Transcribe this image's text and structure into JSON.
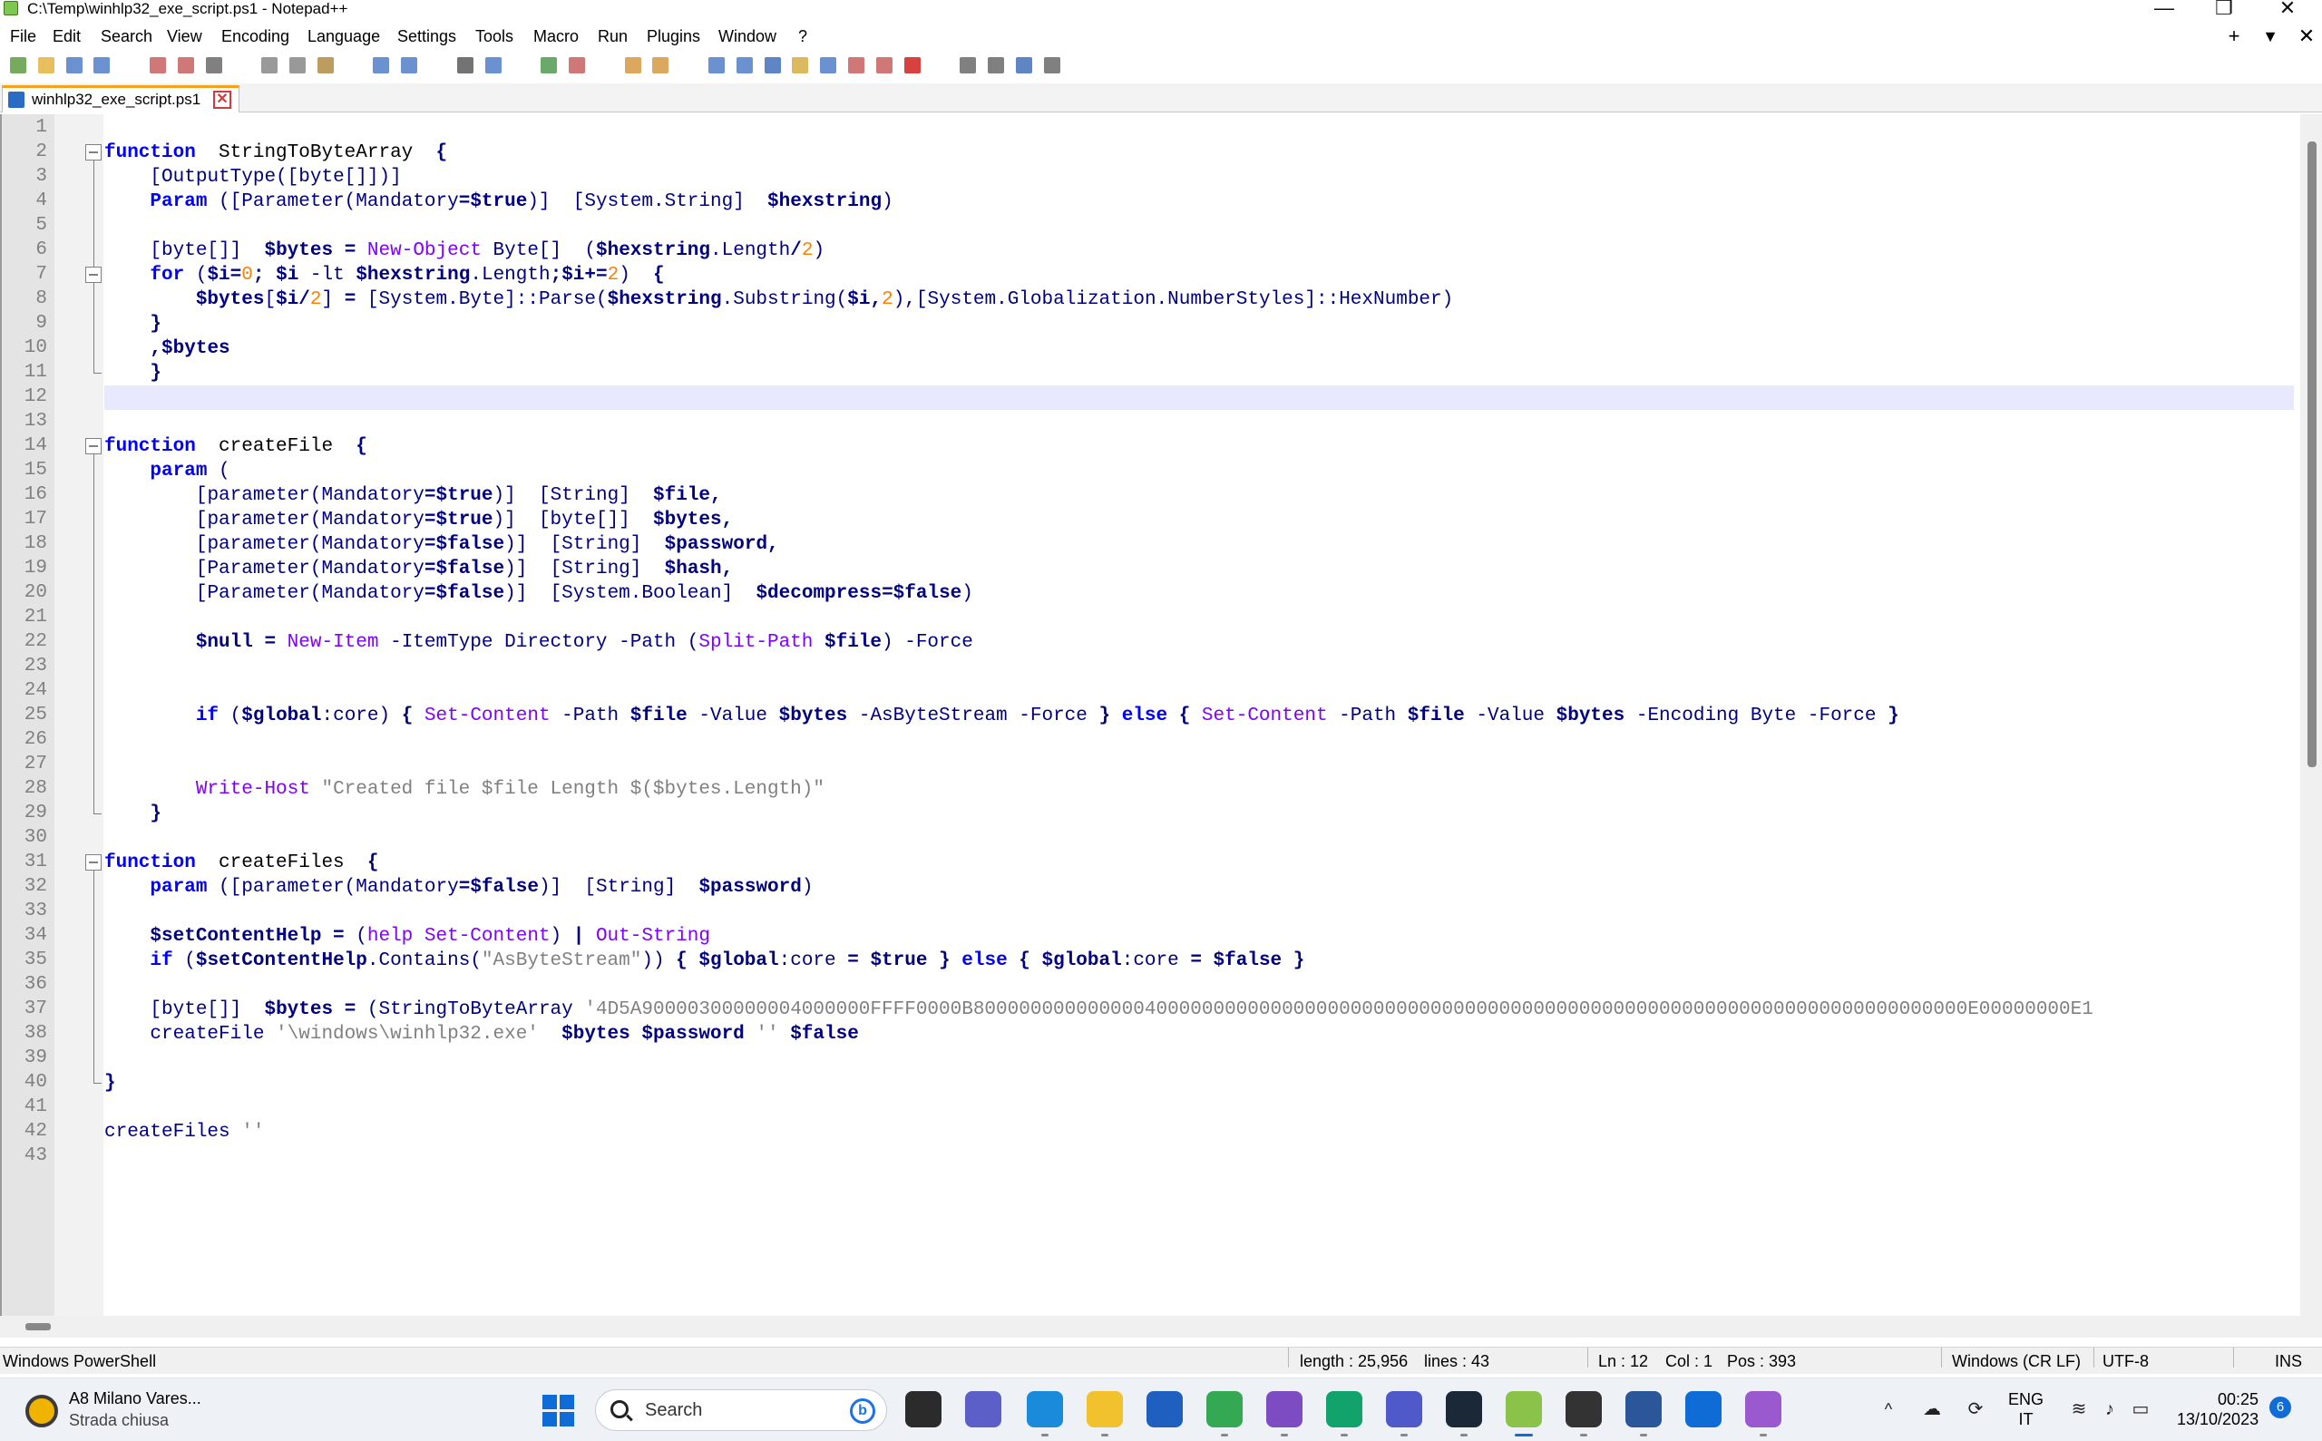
{
  "window": {
    "title": "C:\\Temp\\winhlp32_exe_script.ps1 - Notepad++",
    "minimize": "—",
    "restore": "❐",
    "close": "✕"
  },
  "menu": {
    "items": [
      "File",
      "Edit",
      "Search",
      "View",
      "Encoding",
      "Language",
      "Settings",
      "Tools",
      "Macro",
      "Run",
      "Plugins",
      "Window",
      "?"
    ],
    "right_plus": "+",
    "right_down": "▼",
    "right_close": "✕"
  },
  "toolbar": {
    "icons": [
      "new-file-icon",
      "open-file-icon",
      "save-icon",
      "save-all-icon",
      "close-icon",
      "close-all-icon",
      "print-icon",
      "cut-icon",
      "copy-icon",
      "paste-icon",
      "undo-icon",
      "redo-icon",
      "find-icon",
      "replace-icon",
      "zoom-in-icon",
      "zoom-out-icon",
      "sync-vertical-icon",
      "sync-horizontal-icon",
      "word-wrap-icon",
      "show-all-chars-icon",
      "indent-guide-icon",
      "doc-map-icon",
      "function-list-icon",
      "folder-workspace-icon",
      "monitoring-icon",
      "start-record-icon",
      "stop-record-icon",
      "playback-icon",
      "run-macro-multiple-icon",
      "save-macro-icon"
    ]
  },
  "tab": {
    "name": "winhlp32_exe_script.ps1",
    "close": "✕"
  },
  "editor": {
    "current_line": 12,
    "line_numbers": [
      "1",
      "2",
      "3",
      "4",
      "5",
      "6",
      "7",
      "8",
      "9",
      "10",
      "11",
      "12",
      "13",
      "14",
      "15",
      "16",
      "17",
      "18",
      "19",
      "20",
      "21",
      "22",
      "23",
      "24",
      "25",
      "26",
      "27",
      "28",
      "29",
      "30",
      "31",
      "32",
      "33",
      "34",
      "35",
      "36",
      "37",
      "38",
      "39",
      "40",
      "41",
      "42",
      "43"
    ],
    "lines": [
      [],
      [
        [
          "kw",
          "function"
        ],
        [
          "",
          "  StringToByteArray  "
        ],
        [
          "op",
          "{"
        ]
      ],
      [
        [
          "",
          "    "
        ],
        [
          "br",
          "["
        ],
        [
          "ty",
          "OutputType"
        ],
        [
          "br",
          "([byte[]])]"
        ]
      ],
      [
        [
          "",
          "    "
        ],
        [
          "kw",
          "Param"
        ],
        [
          "",
          ""
        ],
        [
          "br",
          " (["
        ],
        [
          "ty",
          "Parameter"
        ],
        [
          "br",
          "("
        ],
        [
          "ty",
          "Mandatory"
        ],
        [
          "op",
          "="
        ],
        [
          "var",
          "$true"
        ],
        [
          "br",
          ")]"
        ],
        [
          "",
          "  "
        ],
        [
          "br",
          "["
        ],
        [
          "ty",
          "System.String"
        ],
        [
          "br",
          "]"
        ],
        [
          "",
          "  "
        ],
        [
          "var",
          "$hexstring"
        ],
        [
          "br",
          ")"
        ]
      ],
      [],
      [
        [
          "",
          "    "
        ],
        [
          "br",
          "[byte[]]"
        ],
        [
          "",
          "  "
        ],
        [
          "var",
          "$bytes"
        ],
        [
          "",
          ""
        ],
        [
          "op",
          " = "
        ],
        [
          "cmd",
          "New-Object"
        ],
        [
          "ty",
          " Byte[] "
        ],
        [
          "br",
          " ("
        ],
        [
          "var",
          "$hexstring"
        ],
        [
          "ty",
          ".Length"
        ],
        [
          "op",
          "/"
        ],
        [
          "num",
          "2"
        ],
        [
          "br",
          ")"
        ]
      ],
      [
        [
          "",
          "    "
        ],
        [
          "kw",
          "for"
        ],
        [
          "br",
          " ("
        ],
        [
          "var",
          "$i"
        ],
        [
          "op",
          "="
        ],
        [
          "num",
          "0"
        ],
        [
          "op",
          ";"
        ],
        [
          "",
          ""
        ],
        [
          "var",
          " $i"
        ],
        [
          "ty",
          " -lt "
        ],
        [
          "var",
          "$hexstring"
        ],
        [
          "ty",
          ".Length"
        ],
        [
          "op",
          ";"
        ],
        [
          "var",
          "$i"
        ],
        [
          "op",
          "+="
        ],
        [
          "num",
          "2"
        ],
        [
          "br",
          ")"
        ],
        [
          "",
          ""
        ],
        [
          "op",
          "  {"
        ]
      ],
      [
        [
          "",
          "        "
        ],
        [
          "var",
          "$bytes"
        ],
        [
          "br",
          "["
        ],
        [
          "var",
          "$i"
        ],
        [
          "op",
          "/"
        ],
        [
          "num",
          "2"
        ],
        [
          "br",
          "]"
        ],
        [
          "op",
          " = "
        ],
        [
          "br",
          "["
        ],
        [
          "ty",
          "System.Byte"
        ],
        [
          "br",
          "]"
        ],
        [
          "ty",
          "::Parse"
        ],
        [
          "br",
          "("
        ],
        [
          "var",
          "$hexstring"
        ],
        [
          "ty",
          ".Substring"
        ],
        [
          "br",
          "("
        ],
        [
          "var",
          "$i"
        ],
        [
          "op",
          ","
        ],
        [
          "num",
          "2"
        ],
        [
          "br",
          "),["
        ],
        [
          "ty",
          "System.Globalization.NumberStyles"
        ],
        [
          "br",
          "]"
        ],
        [
          "ty",
          "::HexNumber"
        ],
        [
          "br",
          ")"
        ]
      ],
      [
        [
          "",
          "    "
        ],
        [
          "op",
          "}"
        ]
      ],
      [
        [
          "",
          "    "
        ],
        [
          "op",
          ","
        ],
        [
          "var",
          "$bytes"
        ]
      ],
      [
        [
          "",
          "    "
        ],
        [
          "op",
          "}"
        ]
      ],
      [],
      [],
      [
        [
          "kw",
          "function"
        ],
        [
          "",
          "  createFile  "
        ],
        [
          "op",
          "{"
        ]
      ],
      [
        [
          "",
          "    "
        ],
        [
          "kw",
          "param"
        ],
        [
          "br",
          " ("
        ]
      ],
      [
        [
          "",
          "        "
        ],
        [
          "br",
          "["
        ],
        [
          "ty",
          "parameter"
        ],
        [
          "br",
          "("
        ],
        [
          "ty",
          "Mandatory"
        ],
        [
          "op",
          "="
        ],
        [
          "var",
          "$true"
        ],
        [
          "br",
          ")]"
        ],
        [
          "",
          "  "
        ],
        [
          "br",
          "["
        ],
        [
          "ty",
          "String"
        ],
        [
          "br",
          "]"
        ],
        [
          "",
          "  "
        ],
        [
          "var",
          "$file"
        ],
        [
          "op",
          ","
        ]
      ],
      [
        [
          "",
          "        "
        ],
        [
          "br",
          "["
        ],
        [
          "ty",
          "parameter"
        ],
        [
          "br",
          "("
        ],
        [
          "ty",
          "Mandatory"
        ],
        [
          "op",
          "="
        ],
        [
          "var",
          "$true"
        ],
        [
          "br",
          ")]"
        ],
        [
          "",
          "  "
        ],
        [
          "br",
          "[byte[]]"
        ],
        [
          "",
          "  "
        ],
        [
          "var",
          "$bytes"
        ],
        [
          "op",
          ","
        ]
      ],
      [
        [
          "",
          "        "
        ],
        [
          "br",
          "["
        ],
        [
          "ty",
          "parameter"
        ],
        [
          "br",
          "("
        ],
        [
          "ty",
          "Mandatory"
        ],
        [
          "op",
          "="
        ],
        [
          "var",
          "$false"
        ],
        [
          "br",
          ")]"
        ],
        [
          "",
          "  "
        ],
        [
          "br",
          "["
        ],
        [
          "ty",
          "String"
        ],
        [
          "br",
          "]"
        ],
        [
          "",
          "  "
        ],
        [
          "var",
          "$password"
        ],
        [
          "op",
          ","
        ]
      ],
      [
        [
          "",
          "        "
        ],
        [
          "br",
          "["
        ],
        [
          "ty",
          "Parameter"
        ],
        [
          "br",
          "("
        ],
        [
          "ty",
          "Mandatory"
        ],
        [
          "op",
          "="
        ],
        [
          "var",
          "$false"
        ],
        [
          "br",
          ")]"
        ],
        [
          "",
          "  "
        ],
        [
          "br",
          "["
        ],
        [
          "ty",
          "String"
        ],
        [
          "br",
          "]"
        ],
        [
          "",
          "  "
        ],
        [
          "var",
          "$hash"
        ],
        [
          "op",
          ","
        ]
      ],
      [
        [
          "",
          "        "
        ],
        [
          "br",
          "["
        ],
        [
          "ty",
          "Parameter"
        ],
        [
          "br",
          "("
        ],
        [
          "ty",
          "Mandatory"
        ],
        [
          "op",
          "="
        ],
        [
          "var",
          "$false"
        ],
        [
          "br",
          ")]"
        ],
        [
          "",
          "  "
        ],
        [
          "br",
          "["
        ],
        [
          "ty",
          "System.Boolean"
        ],
        [
          "br",
          "]"
        ],
        [
          "",
          "  "
        ],
        [
          "var",
          "$decompress"
        ],
        [
          "op",
          "="
        ],
        [
          "var",
          "$false"
        ],
        [
          "br",
          ")"
        ]
      ],
      [],
      [
        [
          "",
          "        "
        ],
        [
          "var",
          "$null"
        ],
        [
          "op",
          " = "
        ],
        [
          "cmd",
          "New-Item"
        ],
        [
          "ty",
          " -ItemType Directory -Path "
        ],
        [
          "br",
          "("
        ],
        [
          "cmd",
          "Split-Path"
        ],
        [
          "",
          ""
        ],
        [
          "var",
          " $file"
        ],
        [
          "br",
          ")"
        ],
        [
          "ty",
          " -Force"
        ]
      ],
      [],
      [],
      [
        [
          "",
          "        "
        ],
        [
          "kw",
          "if"
        ],
        [
          "br",
          " ("
        ],
        [
          "var",
          "$global"
        ],
        [
          "ty",
          ":core"
        ],
        [
          "br",
          ")"
        ],
        [
          "op",
          " { "
        ],
        [
          "cmd",
          "Set-Content"
        ],
        [
          "ty",
          " -Path "
        ],
        [
          "var",
          "$file"
        ],
        [
          "ty",
          " -Value "
        ],
        [
          "var",
          "$bytes"
        ],
        [
          "ty",
          " -AsByteStream -Force "
        ],
        [
          "op",
          "}"
        ],
        [
          "",
          ""
        ],
        [
          "kw",
          " else"
        ],
        [
          "op",
          " { "
        ],
        [
          "cmd",
          "Set-Content"
        ],
        [
          "ty",
          " -Path "
        ],
        [
          "var",
          "$file"
        ],
        [
          "ty",
          " -Value "
        ],
        [
          "var",
          "$bytes"
        ],
        [
          "ty",
          " -Encoding Byte -Force "
        ],
        [
          "op",
          "}"
        ]
      ],
      [],
      [],
      [
        [
          "",
          "        "
        ],
        [
          "cmd",
          "Write-Host"
        ],
        [
          "str",
          " \"Created file $file Length $($bytes.Length)\""
        ]
      ],
      [
        [
          "",
          "    "
        ],
        [
          "op",
          "}"
        ]
      ],
      [],
      [
        [
          "kw",
          "function"
        ],
        [
          "",
          "  createFiles  "
        ],
        [
          "op",
          "{"
        ]
      ],
      [
        [
          "",
          "    "
        ],
        [
          "kw",
          "param"
        ],
        [
          "br",
          " (["
        ],
        [
          "ty",
          "parameter"
        ],
        [
          "br",
          "("
        ],
        [
          "ty",
          "Mandatory"
        ],
        [
          "op",
          "="
        ],
        [
          "var",
          "$false"
        ],
        [
          "br",
          ")]"
        ],
        [
          "",
          "  "
        ],
        [
          "br",
          "["
        ],
        [
          "ty",
          "String"
        ],
        [
          "br",
          "]"
        ],
        [
          "",
          "  "
        ],
        [
          "var",
          "$password"
        ],
        [
          "br",
          ")"
        ]
      ],
      [],
      [
        [
          "",
          "    "
        ],
        [
          "var",
          "$setContentHelp"
        ],
        [
          "op",
          " = "
        ],
        [
          "br",
          "("
        ],
        [
          "cmd",
          "help"
        ],
        [
          "",
          ""
        ],
        [
          "cmd",
          " Set-Content"
        ],
        [
          "br",
          ")"
        ],
        [
          "op",
          " | "
        ],
        [
          "cmd",
          "Out-String"
        ]
      ],
      [
        [
          "",
          "    "
        ],
        [
          "kw",
          "if"
        ],
        [
          "br",
          " ("
        ],
        [
          "var",
          "$setContentHelp"
        ],
        [
          "ty",
          ".Contains"
        ],
        [
          "br",
          "("
        ],
        [
          "str",
          "\"AsByteStream\""
        ],
        [
          "br",
          "))"
        ],
        [
          "op",
          " { "
        ],
        [
          "var",
          "$global"
        ],
        [
          "ty",
          ":core"
        ],
        [
          "op",
          " = "
        ],
        [
          "var",
          "$true"
        ],
        [
          "op",
          " } "
        ],
        [
          "kw",
          "else"
        ],
        [
          "op",
          " { "
        ],
        [
          "var",
          "$global"
        ],
        [
          "ty",
          ":core"
        ],
        [
          "op",
          " = "
        ],
        [
          "var",
          "$false"
        ],
        [
          "op",
          " }"
        ]
      ],
      [],
      [
        [
          "",
          "    "
        ],
        [
          "br",
          "[byte[]]"
        ],
        [
          "",
          "  "
        ],
        [
          "var",
          "$bytes"
        ],
        [
          "op",
          " = "
        ],
        [
          "br",
          "("
        ],
        [
          "ty",
          "StringToByteArray "
        ],
        [
          "str",
          "'4D5A90000300000004000000FFFF0000B800000000000000400000000000000000000000000000000000000000000000000000000000000000000000E00000000E1"
        ]
      ],
      [
        [
          "",
          "    "
        ],
        [
          "ty",
          "createFile "
        ],
        [
          "str",
          "'\\windows\\winhlp32.exe'"
        ],
        [
          "",
          "  "
        ],
        [
          "var",
          "$bytes"
        ],
        [
          "",
          ""
        ],
        [
          "var",
          " $password"
        ],
        [
          "str",
          " ''"
        ],
        [
          "",
          ""
        ],
        [
          "var",
          " $false"
        ]
      ],
      [],
      [
        [
          "",
          ""
        ],
        [
          "op",
          "}"
        ]
      ],
      [],
      [
        [
          "ty",
          "createFiles "
        ],
        [
          "str",
          "''"
        ]
      ],
      []
    ]
  },
  "status": {
    "lang": "Windows PowerShell",
    "length": "length : 25,956",
    "lines": "lines : 43",
    "ln": "Ln : 12",
    "col": "Col : 1",
    "pos": "Pos : 393",
    "eol": "Windows (CR LF)",
    "enc": "UTF-8",
    "mode": "INS"
  },
  "taskbar": {
    "weather_title": "A8 Milano Vares...",
    "weather_sub": "Strada chiusa",
    "search_placeholder": "Search",
    "bing": "b",
    "apps": [
      {
        "name": "task-view-icon",
        "color": "#2b2b2b"
      },
      {
        "name": "chat-icon",
        "color": "#5b5fc7"
      },
      {
        "name": "edge-icon",
        "color": "#1a8adb"
      },
      {
        "name": "file-explorer-icon",
        "color": "#f2c12e"
      },
      {
        "name": "store-icon",
        "color": "#1f5fbf"
      },
      {
        "name": "chrome-icon",
        "color": "#34a853"
      },
      {
        "name": "visual-studio-icon",
        "color": "#7e4cc2"
      },
      {
        "name": "shield-app-icon",
        "color": "#11a36b"
      },
      {
        "name": "teams-icon",
        "color": "#5059c9"
      },
      {
        "name": "steam-icon",
        "color": "#1b2838"
      },
      {
        "name": "notepadpp-icon",
        "color": "#8bc34a"
      },
      {
        "name": "terminal-icon",
        "color": "#333333"
      },
      {
        "name": "word-icon",
        "color": "#2b579a"
      },
      {
        "name": "defender-icon",
        "color": "#0f6cd6"
      },
      {
        "name": "vs-installer-icon",
        "color": "#9b59d0"
      }
    ],
    "lang1": "ENG",
    "lang2": "IT",
    "time": "00:25",
    "date": "13/10/2023",
    "notifications": "6"
  }
}
